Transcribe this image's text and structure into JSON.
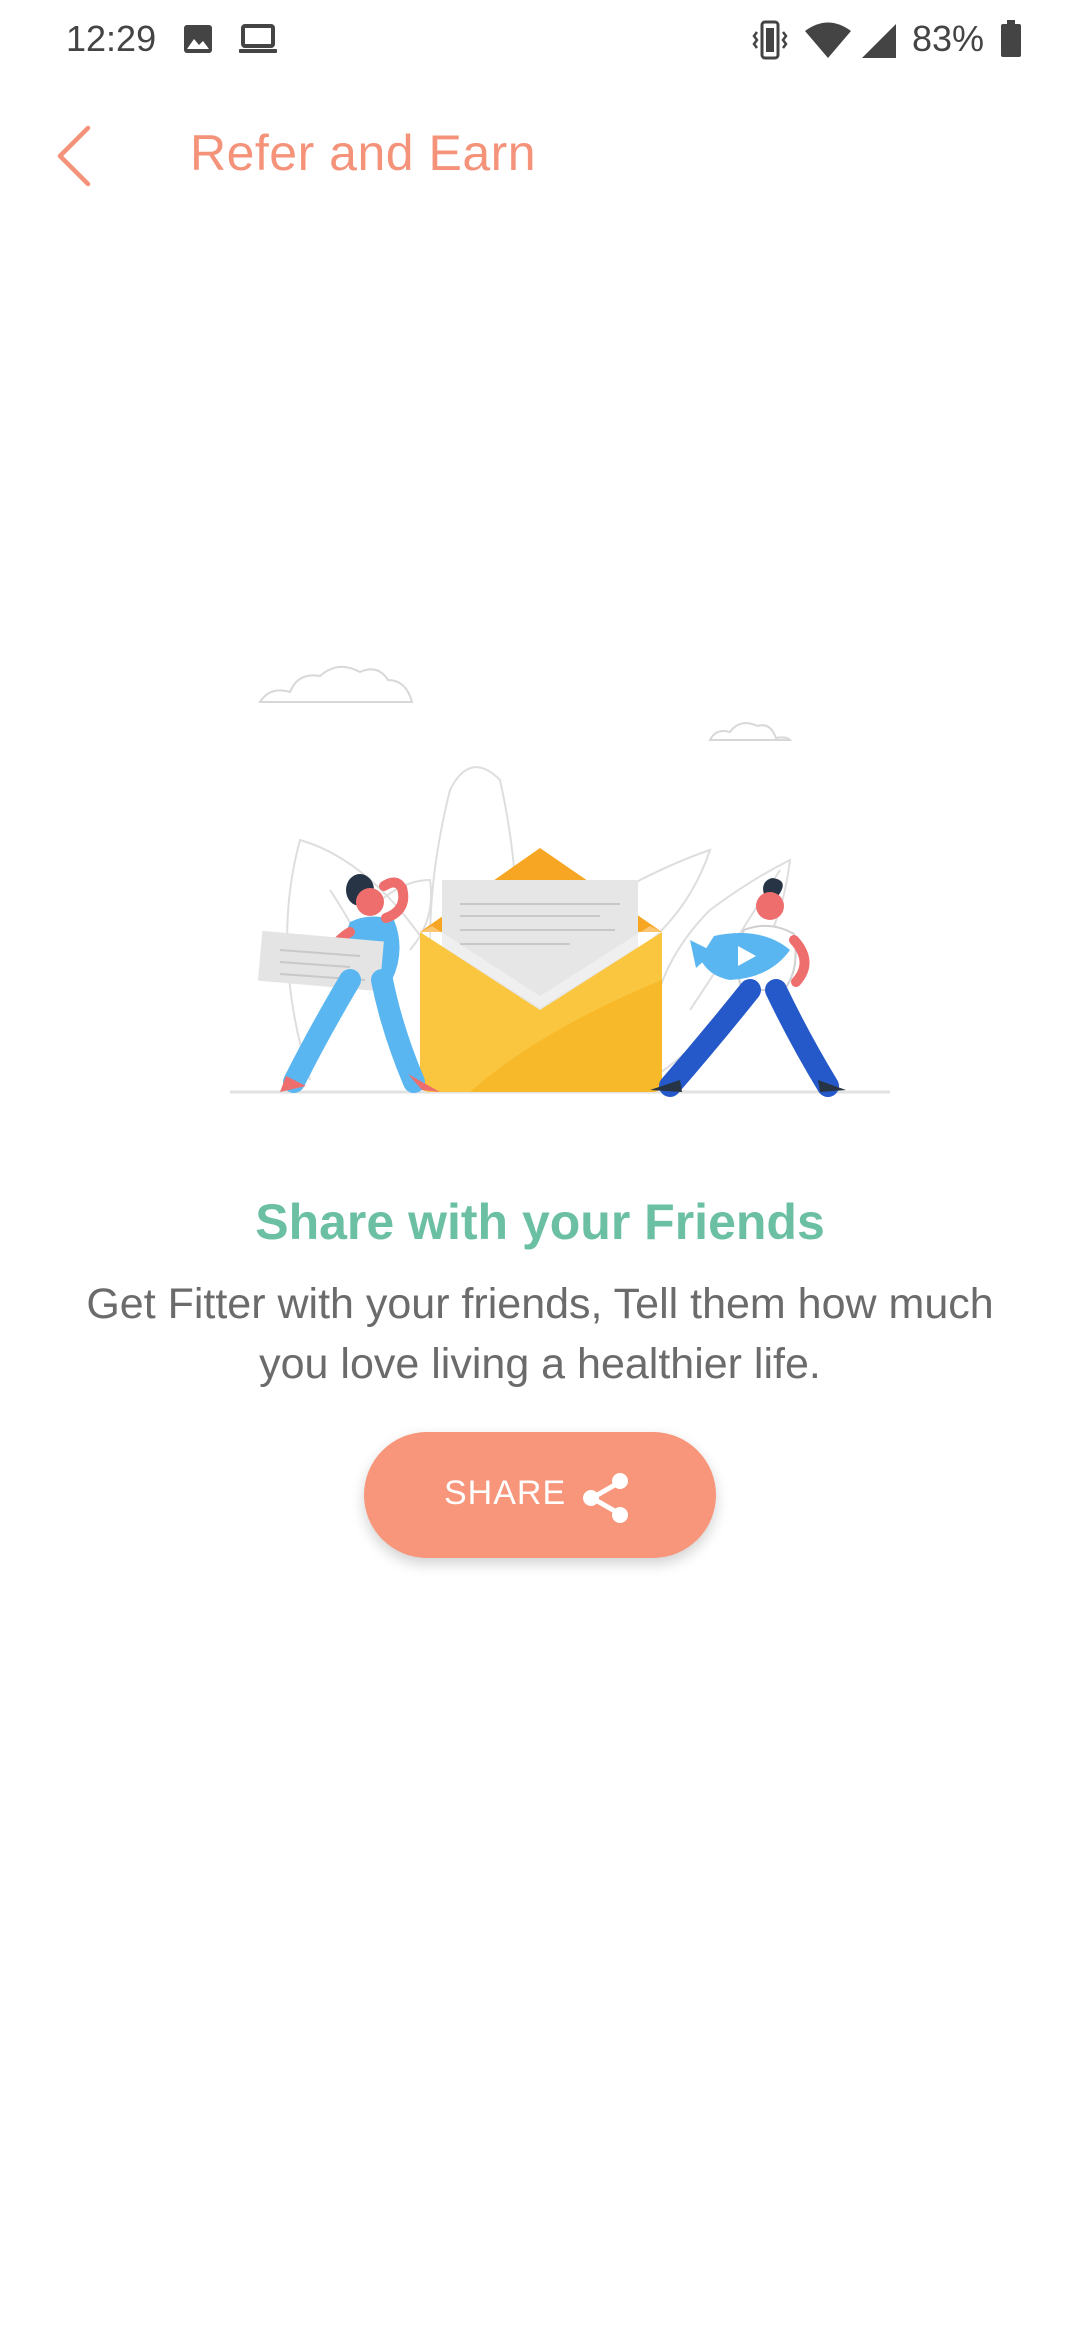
{
  "status_bar": {
    "time": "12:29",
    "battery_percent": "83%",
    "icons": [
      "image-icon",
      "laptop-icon",
      "vibrate-icon",
      "wifi-icon",
      "signal-icon",
      "battery-icon"
    ]
  },
  "app_bar": {
    "title": "Refer and Earn",
    "back_icon": "chevron-left-icon"
  },
  "content": {
    "illustration": "refer-friends-envelope-illustration",
    "headline": "Share with your Friends",
    "description": "Get Fitter with your friends, Tell them how much you love living a healthier life.",
    "share_button": {
      "label": "SHARE",
      "icon": "share-icon"
    }
  },
  "colors": {
    "accent": "#f4937a",
    "button": "#f8967b",
    "headline": "#6bbfa3",
    "body_text": "#6b6b6b"
  }
}
